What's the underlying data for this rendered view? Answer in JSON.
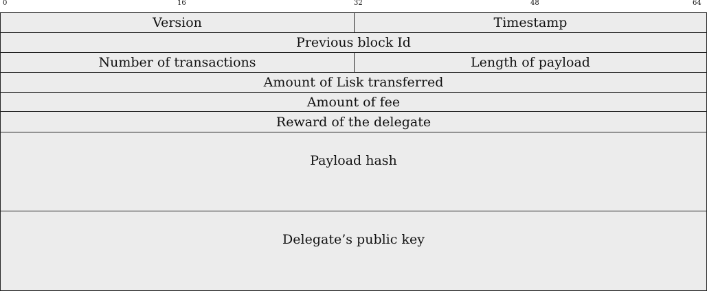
{
  "ruler": {
    "ticks": [
      "0",
      "16",
      "32",
      "48",
      "64"
    ]
  },
  "fields": {
    "version": "Version",
    "timestamp": "Timestamp",
    "previous_block_id": "Previous block Id",
    "number_of_transactions": "Number of transactions",
    "length_of_payload": "Length of payload",
    "amount_transferred": "Amount of Lisk transferred",
    "amount_of_fee": "Amount of fee",
    "reward": "Reward of the delegate",
    "payload_hash": "Payload hash",
    "public_key": "Delegate’s public key"
  },
  "colors": {
    "cell_fill": "#ececec",
    "border": "#222222"
  }
}
